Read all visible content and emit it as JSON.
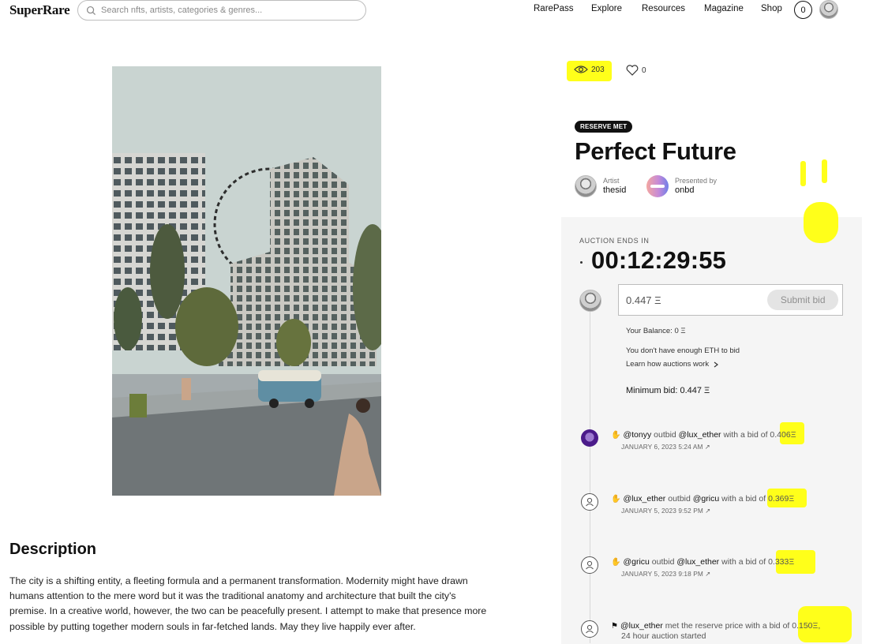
{
  "header": {
    "logo": "SuperRare",
    "search_placeholder": "Search nfts, artists, categories & genres...",
    "nav": [
      "RarePass",
      "Explore",
      "Resources",
      "Magazine",
      "Shop"
    ],
    "notifications_count": "0"
  },
  "stats": {
    "views": "203",
    "likes": "0"
  },
  "artwork": {
    "badge": "RESERVE MET",
    "title": "Perfect Future",
    "artist_role": "Artist",
    "artist_name": "thesid",
    "presenter_role": "Presented by",
    "presenter_name": "onbd"
  },
  "auction": {
    "ends_label": "AUCTION ENDS IN",
    "timer": "00:12:29:55",
    "bid_value": "0.447 Ξ",
    "submit_label": "Submit bid",
    "balance": "Your Balance: 0 Ξ",
    "warning": "You don't have enough ETH to bid",
    "learn": "Learn how auctions work",
    "min_bid": "Minimum bid: 0.447 Ξ"
  },
  "history": [
    {
      "icon": "hand-icon",
      "user": "@tonyy",
      "action": "outbid",
      "target": "@lux_ether",
      "text": "with a bid of",
      "amount": "0.406Ξ",
      "date": "JANUARY 6, 2023 5:24 AM ↗"
    },
    {
      "icon": "hand-icon",
      "user": "@lux_ether",
      "action": "outbid",
      "target": "@gricu",
      "text": "with a bid of",
      "amount": "0.369Ξ",
      "date": "JANUARY 5, 2023 9:52 PM ↗"
    },
    {
      "icon": "hand-icon",
      "user": "@gricu",
      "action": "outbid",
      "target": "@lux_ether",
      "text": "with a bid of",
      "amount": "0.333Ξ",
      "date": "JANUARY 5, 2023 9:18 PM ↗"
    },
    {
      "icon": "flag-icon",
      "user": "@lux_ether",
      "action": "met the reserve price with a bid of",
      "amount": "0.150Ξ,",
      "line2": "24 hour auction started"
    }
  ],
  "description": {
    "title": "Description",
    "text": "The city is a shifting entity, a fleeting formula and a permanent transformation. Modernity might have drawn humans attention to the mere word but it was the traditional anatomy and architecture that built the city's premise. In a creative world, however, the two can be peacefully present. I attempt to make that presence more possible by putting together modern souls in far-fetched lands. May they live happily ever after."
  },
  "colors": {
    "highlight": "#ffff1a",
    "panel": "#f5f5f5",
    "badge": "#111111"
  }
}
